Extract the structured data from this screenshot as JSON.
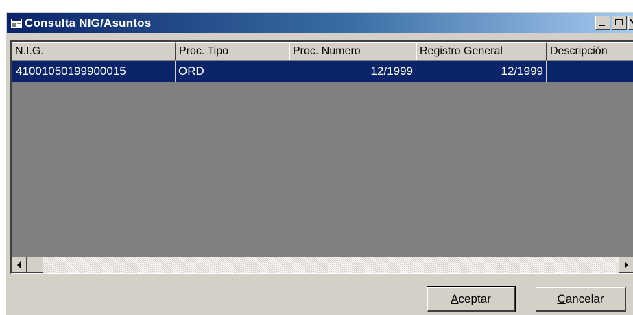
{
  "window": {
    "title": "Consulta NIG/Asuntos",
    "title_icon": "app-window-icon",
    "controls": [
      "minimize-icon",
      "maximize-icon",
      "close-icon"
    ]
  },
  "table": {
    "columns": [
      "N.I.G.",
      "Proc. Tipo",
      "Proc. Numero",
      "Registro General",
      "Descripción"
    ],
    "rows": [
      {
        "nig": "41001050199900015",
        "proc_tipo": "ORD",
        "proc_numero": "12/1999",
        "registro_general": "12/1999",
        "descripcion": ""
      }
    ],
    "selected_row": 0
  },
  "buttons": {
    "accept": {
      "accel": "A",
      "rest": "ceptar"
    },
    "cancel": {
      "accel": "C",
      "rest": "ancelar"
    }
  },
  "colors": {
    "selection": "#0a246a",
    "list_background": "#808080",
    "face": "#d4d0c8"
  }
}
